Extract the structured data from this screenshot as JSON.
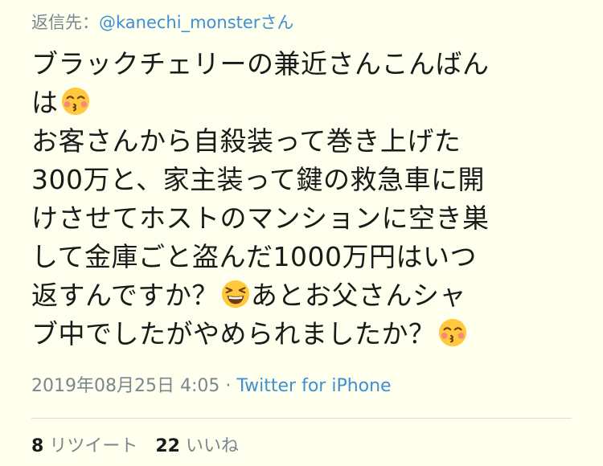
{
  "reply": {
    "prefix": "返信先：",
    "handle": "@kanechi_monster",
    "suffix": "さん"
  },
  "tweet": {
    "lines": [
      "ブラックチェリーの兼近さんこんばん",
      "は",
      "お客さんから自殺装って巻き上げた",
      "300万と、家主装って鍵の救急車に開",
      "けさせてホストのマンションに空き巣",
      "して金庫ごと盗んだ1000万円はいつ",
      "返すんですか？",
      "あとお父さんシャ",
      "ブ中でしたがやめられましたか？"
    ],
    "emojis": [
      "kissing-face",
      "grinning-squinting-face",
      "kissing-face"
    ]
  },
  "meta": {
    "timestamp": "2019年08月25日 4:05",
    "separator": " · ",
    "source": "Twitter for iPhone"
  },
  "stats": {
    "retweet_count": "8",
    "retweet_label": "リツイート",
    "like_count": "22",
    "like_label": "いいね"
  }
}
